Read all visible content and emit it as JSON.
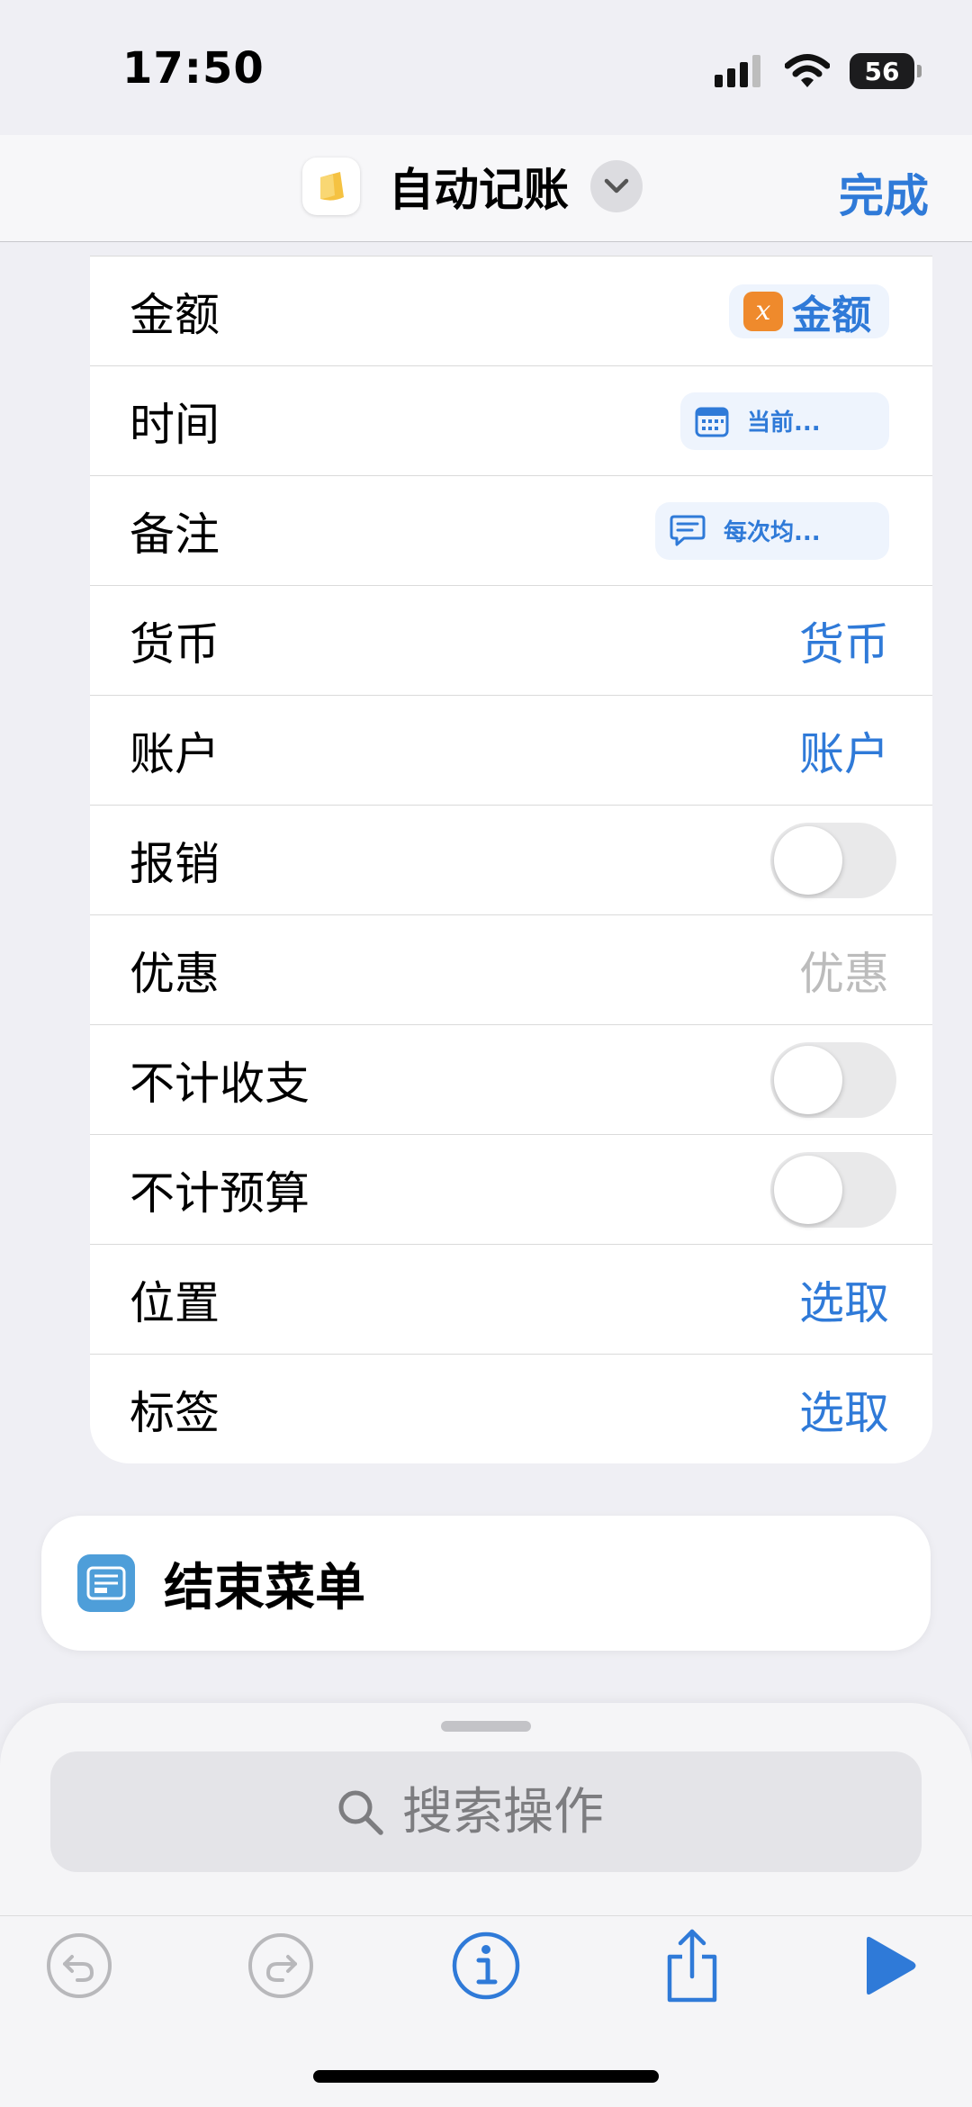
{
  "status_bar": {
    "time": "17:50",
    "battery": "56"
  },
  "nav": {
    "title": "自动记账",
    "done_label": "完成"
  },
  "form": {
    "rows": [
      {
        "label": "金额",
        "value": "金额"
      },
      {
        "label": "时间",
        "value": "当前..."
      },
      {
        "label": "备注",
        "value": "每次均..."
      },
      {
        "label": "货币",
        "value": "货币"
      },
      {
        "label": "账户",
        "value": "账户"
      },
      {
        "label": "报销",
        "value": "off"
      },
      {
        "label": "优惠",
        "value": "优惠"
      },
      {
        "label": "不计收支",
        "value": "off"
      },
      {
        "label": "不计预算",
        "value": "off"
      },
      {
        "label": "位置",
        "value": "选取"
      },
      {
        "label": "标签",
        "value": "选取"
      }
    ]
  },
  "end_menu": {
    "label": "结束菜单"
  },
  "search": {
    "placeholder": "搜索操作"
  },
  "icons": {
    "app": "app-wallet-icon",
    "amount_var": "variable-x-icon",
    "time": "calendar-icon",
    "note": "chat-bubble-icon",
    "end_menu": "menu-list-icon",
    "search": "search-icon",
    "undo": "undo-icon",
    "redo": "redo-icon",
    "info": "info-icon",
    "share": "share-icon",
    "play": "play-icon"
  },
  "colors": {
    "accent": "#2f7ad8",
    "variable": "#ef8a2c",
    "menu_icon": "#4e9ed9",
    "app_icon": "#f5c242"
  }
}
